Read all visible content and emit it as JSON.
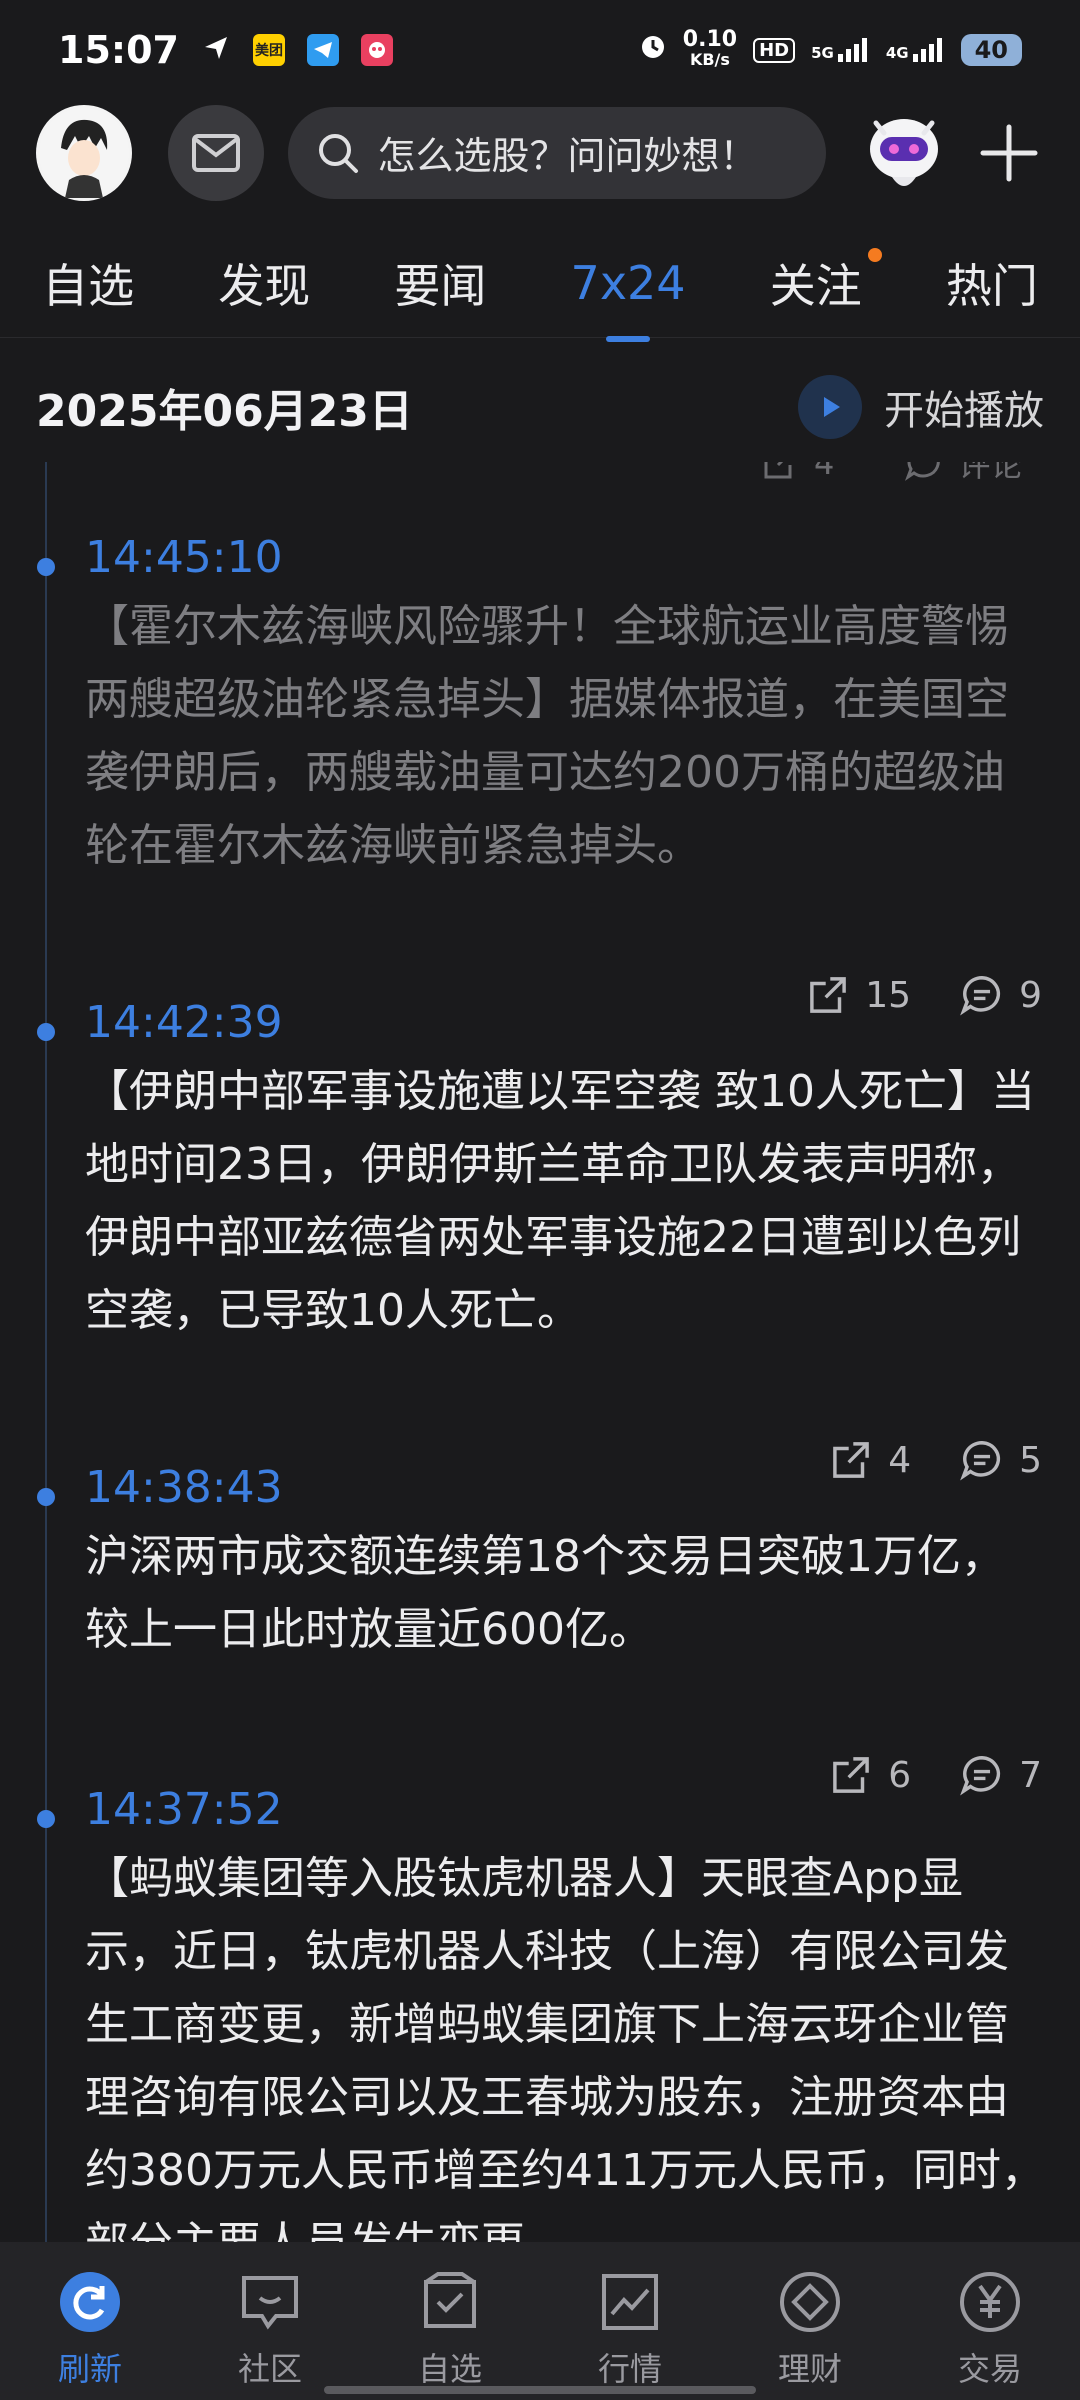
{
  "status_bar": {
    "time": "15:07",
    "app1": "美团",
    "net_speed": "0.10",
    "net_unit": "KB/s",
    "hd": "HD",
    "sig1": "5G",
    "sig2": "4G",
    "battery": "40"
  },
  "header": {
    "search_placeholder": "怎么选股？问问妙想！"
  },
  "tabs": [
    {
      "label": "自选"
    },
    {
      "label": "发现"
    },
    {
      "label": "要闻"
    },
    {
      "label": "7x24"
    },
    {
      "label": "关注"
    },
    {
      "label": "热门"
    }
  ],
  "date_row": {
    "date": "2025年06月23日",
    "play_label": "开始播放"
  },
  "top_actions": {
    "share": "4",
    "comment": "评论"
  },
  "news": [
    {
      "time": "14:45:10",
      "text": "【霍尔木兹海峡风险骤升！全球航运业高度警惕 两艘超级油轮紧急掉头】据媒体报道，在美国空袭伊朗后，两艘载油量可达约200万桶的超级油轮在霍尔木兹海峡前紧急掉头。",
      "shares": "15",
      "comments": "9"
    },
    {
      "time": "14:42:39",
      "text": "【伊朗中部军事设施遭以军空袭 致10人死亡】当地时间23日，伊朗伊斯兰革命卫队发表声明称，伊朗中部亚兹德省两处军事设施22日遭到以色列空袭，已导致10人死亡。",
      "shares": "4",
      "comments": "5"
    },
    {
      "time": "14:38:43",
      "text": "沪深两市成交额连续第18个交易日突破1万亿，较上一日此时放量近600亿。",
      "shares": "6",
      "comments": "7"
    },
    {
      "time": "14:37:52",
      "text": "【蚂蚁集团等入股钛虎机器人】天眼查App显示，近日，钛虎机器人科技（上海）有限公司发生工商变更，新增蚂蚁集团旗下上海云玡企业管理咨询有限公司以及王春城为股东，注册资本由约380万元人民币增至约411万元人民币，同时，部分主要人员发生变更。"
    }
  ],
  "bottom_nav": [
    {
      "label": "刷新"
    },
    {
      "label": "社区"
    },
    {
      "label": "自选"
    },
    {
      "label": "行情"
    },
    {
      "label": "理财"
    },
    {
      "label": "交易"
    }
  ],
  "colors": {
    "accent": "#3d7fe0",
    "background": "#1a1a1c",
    "notification_dot": "#f57b20"
  }
}
